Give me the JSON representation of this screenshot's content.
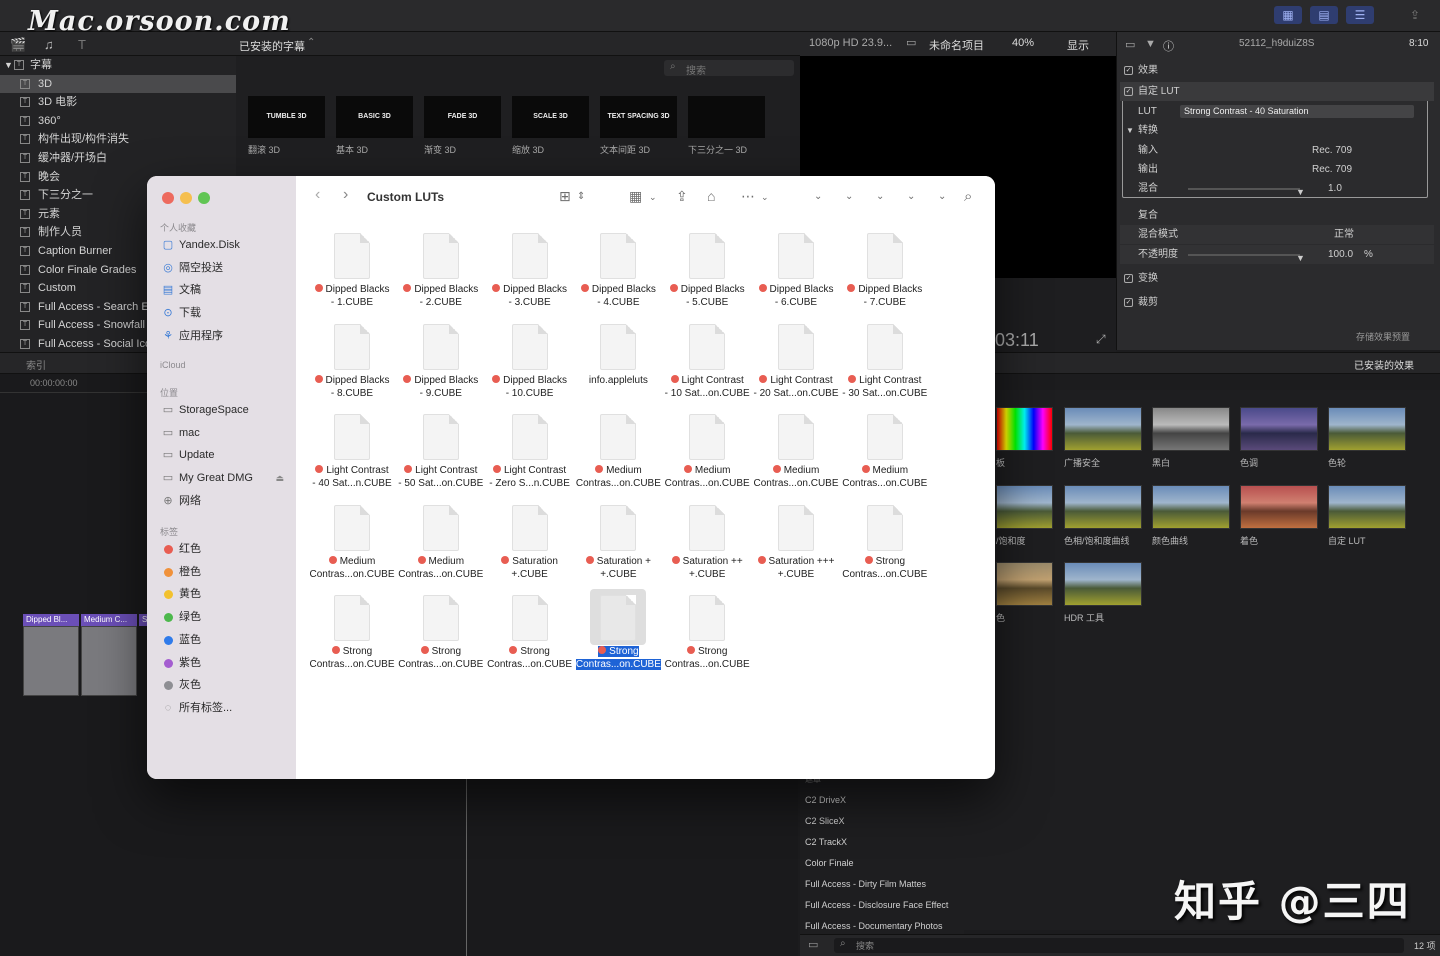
{
  "watermark": {
    "site": "Mac.orsoon.com",
    "zhihu": "知乎 @三四"
  },
  "fcp": {
    "browser_header": "已安装的字幕",
    "library_items": [
      "字幕",
      "3D",
      "3D 电影",
      "360°",
      "构件出现/构件消失",
      "缓冲器/开场白",
      "晚会",
      "下三分之一",
      "元素",
      "制作人员",
      "Caption Burner",
      "Color Finale Grades",
      "Custom",
      "Full Access - Search E",
      "Full Access - Snowfall",
      "Full Access - Social Ico"
    ],
    "titles": [
      {
        "thumb": "TUMBLE 3D",
        "label": "翻滚 3D"
      },
      {
        "thumb": "BASIC 3D",
        "label": "基本 3D"
      },
      {
        "thumb": "FADE 3D",
        "label": "渐变 3D"
      },
      {
        "thumb": "SCALE 3D",
        "label": "缩放 3D"
      },
      {
        "thumb": "TEXT SPACING 3D",
        "label": "文本间距 3D"
      },
      {
        "thumb": "",
        "label": "下三分之一 3D"
      }
    ],
    "search_placeholder": "搜索",
    "viewer": {
      "format": "1080p HD 23.9...",
      "project": "未命名项目",
      "zoom": "40%",
      "display": "显示",
      "timecode": ":03:11"
    },
    "inspector": {
      "clip_name": "52112_h9duiZ8S",
      "clip_time": "8:10",
      "effects": "效果",
      "custom_lut": "自定 LUT",
      "lut_label": "LUT",
      "lut_value": "Strong Contrast - 40 Saturation",
      "convert": "转换",
      "input_label": "输入",
      "input_value": "Rec. 709",
      "output_label": "输出",
      "output_value": "Rec. 709",
      "mix_label": "混合",
      "mix_value": "1.0",
      "composite": "复合",
      "blend_mode_label": "混合模式",
      "blend_mode_value": "正常",
      "opacity_label": "不透明度",
      "opacity_value": "100.0",
      "opacity_unit": "%",
      "transform": "变换",
      "crop": "裁剪",
      "save_preset": "存储效果预置"
    },
    "timeline": {
      "index": "索引",
      "timecode": "00:00:00:00"
    },
    "clips": [
      "Dipped Bl...",
      "Medium C...",
      "S"
    ],
    "effects_header": "已安装的效果",
    "effects": [
      {
        "label": "板"
      },
      {
        "label": "广播安全"
      },
      {
        "label": "黑白"
      },
      {
        "label": "色调"
      },
      {
        "label": "色轮"
      },
      {
        "label": "/饱和度"
      },
      {
        "label": "色相/饱和度曲线"
      },
      {
        "label": "颜色曲线"
      },
      {
        "label": "着色"
      },
      {
        "label": "自定 LUT"
      },
      {
        "label": "色"
      },
      {
        "label": "HDR 工具"
      }
    ],
    "effect_categories": [
      "遮罩",
      "C2 DriveX",
      "C2 SliceX",
      "C2 TrackX",
      "Color Finale",
      "Full Access - Dirty Film Mattes",
      "Full Access - Disclosure Face Effect",
      "Full Access - Documentary Photos"
    ],
    "bottom_search": "搜索",
    "item_count": "12 项"
  },
  "finder": {
    "title": "Custom LUTs",
    "sidebar": {
      "favorites_header": "个人收藏",
      "favorites": [
        {
          "label": "Yandex.Disk",
          "icon": "folder-icon"
        },
        {
          "label": "隔空投送",
          "icon": "airdrop-icon"
        },
        {
          "label": "文稿",
          "icon": "document-icon"
        },
        {
          "label": "下载",
          "icon": "download-icon"
        },
        {
          "label": "应用程序",
          "icon": "apps-icon"
        }
      ],
      "icloud_header": "iCloud",
      "locations_header": "位置",
      "locations": [
        {
          "label": "StorageSpace",
          "icon": "drive-icon"
        },
        {
          "label": "mac",
          "icon": "drive-icon"
        },
        {
          "label": "Update",
          "icon": "drive-icon"
        },
        {
          "label": "My Great DMG",
          "icon": "drive-icon"
        },
        {
          "label": "网络",
          "icon": "network-icon"
        }
      ],
      "tags_header": "标签",
      "tags": [
        {
          "label": "红色",
          "color": "#e85d52"
        },
        {
          "label": "橙色",
          "color": "#f0913a"
        },
        {
          "label": "黄色",
          "color": "#f2c12e"
        },
        {
          "label": "绿色",
          "color": "#4cb84c"
        },
        {
          "label": "蓝色",
          "color": "#2f7bea"
        },
        {
          "label": "紫色",
          "color": "#a45dd0"
        },
        {
          "label": "灰色",
          "color": "#8e8e93"
        },
        {
          "label": "所有标签...",
          "color": ""
        }
      ]
    },
    "files": [
      {
        "l1": "Dipped Blacks",
        "l2": "- 1.CUBE",
        "tag": true
      },
      {
        "l1": "Dipped Blacks",
        "l2": "- 2.CUBE",
        "tag": true
      },
      {
        "l1": "Dipped Blacks",
        "l2": "- 3.CUBE",
        "tag": true
      },
      {
        "l1": "Dipped Blacks",
        "l2": "- 4.CUBE",
        "tag": true
      },
      {
        "l1": "Dipped Blacks",
        "l2": "- 5.CUBE",
        "tag": true
      },
      {
        "l1": "Dipped Blacks",
        "l2": "- 6.CUBE",
        "tag": true
      },
      {
        "l1": "Dipped Blacks",
        "l2": "- 7.CUBE",
        "tag": true
      },
      {
        "l1": "Dipped Blacks",
        "l2": "- 8.CUBE",
        "tag": true
      },
      {
        "l1": "Dipped Blacks",
        "l2": "- 9.CUBE",
        "tag": true
      },
      {
        "l1": "Dipped Blacks",
        "l2": "- 10.CUBE",
        "tag": true
      },
      {
        "l1": "info.appleluts",
        "l2": "",
        "tag": false
      },
      {
        "l1": "Light Contrast",
        "l2": "- 10 Sat...on.CUBE",
        "tag": true
      },
      {
        "l1": "Light Contrast",
        "l2": "- 20 Sat...on.CUBE",
        "tag": true
      },
      {
        "l1": "Light Contrast",
        "l2": "- 30 Sat...on.CUBE",
        "tag": true
      },
      {
        "l1": "Light Contrast",
        "l2": "- 40 Sat...n.CUBE",
        "tag": true
      },
      {
        "l1": "Light Contrast",
        "l2": "- 50 Sat...on.CUBE",
        "tag": true
      },
      {
        "l1": "Light Contrast",
        "l2": "- Zero S...n.CUBE",
        "tag": true
      },
      {
        "l1": "Medium",
        "l2": "Contras...on.CUBE",
        "tag": true
      },
      {
        "l1": "Medium",
        "l2": "Contras...on.CUBE",
        "tag": true
      },
      {
        "l1": "Medium",
        "l2": "Contras...on.CUBE",
        "tag": true
      },
      {
        "l1": "Medium",
        "l2": "Contras...on.CUBE",
        "tag": true
      },
      {
        "l1": "Medium",
        "l2": "Contras...on.CUBE",
        "tag": true
      },
      {
        "l1": "Medium",
        "l2": "Contras...on.CUBE",
        "tag": true
      },
      {
        "l1": "Saturation",
        "l2": "+.CUBE",
        "tag": true
      },
      {
        "l1": "Saturation +",
        "l2": "+.CUBE",
        "tag": true
      },
      {
        "l1": "Saturation ++",
        "l2": "+.CUBE",
        "tag": true
      },
      {
        "l1": "Saturation +++",
        "l2": "+.CUBE",
        "tag": true
      },
      {
        "l1": "Strong",
        "l2": "Contras...on.CUBE",
        "tag": true
      },
      {
        "l1": "Strong",
        "l2": "Contras...on.CUBE",
        "tag": true
      },
      {
        "l1": "Strong",
        "l2": "Contras...on.CUBE",
        "tag": true
      },
      {
        "l1": "Strong",
        "l2": "Contras...on.CUBE",
        "tag": true
      },
      {
        "l1": "Strong",
        "l2": "Contras...on.CUBE",
        "tag": true,
        "selected": true
      },
      {
        "l1": "Strong",
        "l2": "Contras...on.CUBE",
        "tag": true
      }
    ]
  }
}
